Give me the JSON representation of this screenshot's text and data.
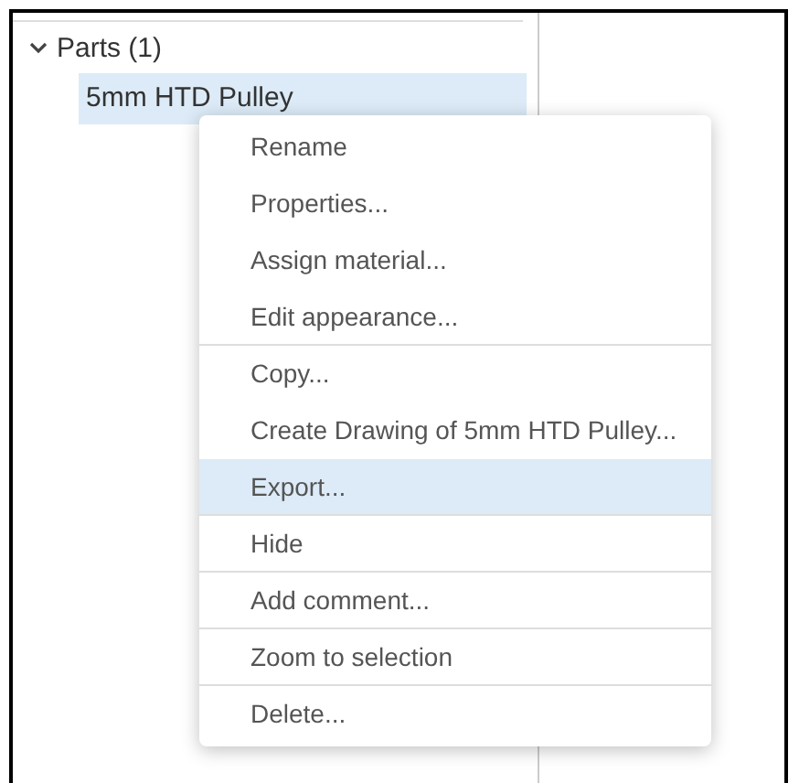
{
  "tree": {
    "group": {
      "label": "Parts (1)",
      "expanded": true,
      "children": [
        {
          "label": "5mm HTD Pulley",
          "selected": true
        }
      ]
    }
  },
  "context_menu": {
    "items": [
      {
        "label": "Rename",
        "selected": false,
        "divider_after": false
      },
      {
        "label": "Properties...",
        "selected": false,
        "divider_after": false
      },
      {
        "label": "Assign material...",
        "selected": false,
        "divider_after": false
      },
      {
        "label": "Edit appearance...",
        "selected": false,
        "divider_after": true
      },
      {
        "label": "Copy...",
        "selected": false,
        "divider_after": false
      },
      {
        "label": "Create Drawing of 5mm HTD Pulley...",
        "selected": false,
        "divider_after": false
      },
      {
        "label": "Export...",
        "selected": true,
        "divider_after": true
      },
      {
        "label": "Hide",
        "selected": false,
        "divider_after": true
      },
      {
        "label": "Add comment...",
        "selected": false,
        "divider_after": true
      },
      {
        "label": "Zoom to selection",
        "selected": false,
        "divider_after": true
      },
      {
        "label": "Delete...",
        "selected": false,
        "divider_after": false
      }
    ]
  }
}
